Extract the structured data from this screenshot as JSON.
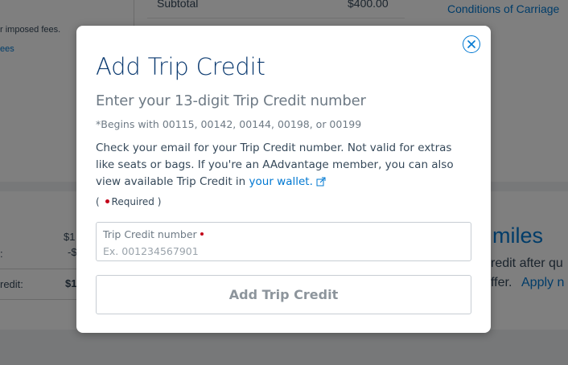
{
  "background": {
    "subtotal_label": "Subtotal",
    "subtotal_value": "$400.00",
    "conditions_link": "Conditions of Carriage",
    "fees_text": "r imposed fees.",
    "fees_link": "ees",
    "row1_value": "$1",
    "row2_label": ":",
    "row2_value": "-$",
    "row3_label": "redit:",
    "row3_value": "$1",
    "miles_heading": "miles",
    "miles_text_1": "redit after qu",
    "miles_text_2": "ffer.",
    "miles_apply_link": "Apply n"
  },
  "modal": {
    "close_icon": "close-icon",
    "title": "Add Trip Credit",
    "subtitle": "Enter your 13-digit Trip Credit number",
    "hint": "*Begins with 00115, 00142, 00144, 00198, or 00199",
    "body_text": "Check your email for your Trip Credit number.  Not valid for extras like seats or bags. If you're an AAdvantage member, you can also view available Trip Credit in ",
    "wallet_link": "your wallet.",
    "external_link_icon": "external-link-icon",
    "required_open": "(",
    "required_label": "Required",
    "required_close": ")",
    "field_label": "Trip Credit number",
    "field_value": "",
    "field_placeholder": "Ex. 001234567901",
    "submit_label": "Add Trip Credit"
  },
  "colors": {
    "brand_navy": "#0b3a70",
    "link_blue": "#0078d2",
    "required_red": "#c30019",
    "overlay": "rgba(0,0,0,0.5)"
  }
}
